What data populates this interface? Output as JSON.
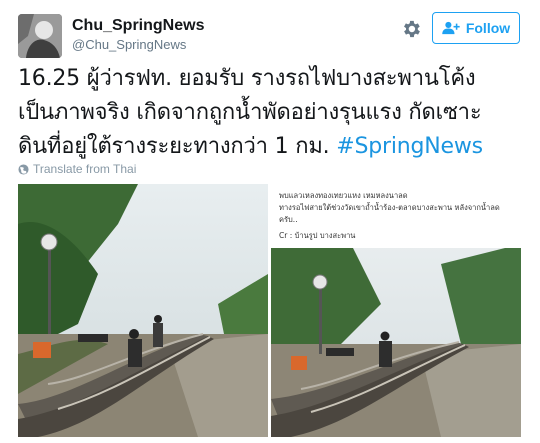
{
  "user": {
    "name": "Chu_SpringNews",
    "handle": "@Chu_SpringNews"
  },
  "actions": {
    "follow_label": "Follow",
    "settings_icon": "gear-icon",
    "follow_icon": "add-user-icon"
  },
  "tweet": {
    "line1": "16.25 ผู้ว่ารฟท. ยอมรับ รางรถไฟบางสะพานโค้ง",
    "line2": "เป็นภาพจริง เกิดจากถูกน้ำพัดอย่างรุนแรง กัดเซาะ",
    "line3_text": "ดินที่อยู่ใต้รางระยะทางกว่า 1 กม. ",
    "hashtag": "#SpringNews"
  },
  "translate": {
    "label": "Translate from Thai",
    "icon": "globe-icon"
  },
  "photo_right_caption": {
    "line1": "พบแลวเหลงทองเทยวแหง เหมหลงนาลด",
    "line2": "ทางรอไฟสายใต้ช่วงวัดเขาถ้ำน้ำร้อง-ตลาดบางสะพาน หลังจากน้ำลด",
    "line3": "ครับ..",
    "credit": "Cr : บ้านรูป บางสะพาน"
  },
  "colors": {
    "link": "#1b95e0",
    "follow": "#1da1f2",
    "muted": "#657786"
  }
}
